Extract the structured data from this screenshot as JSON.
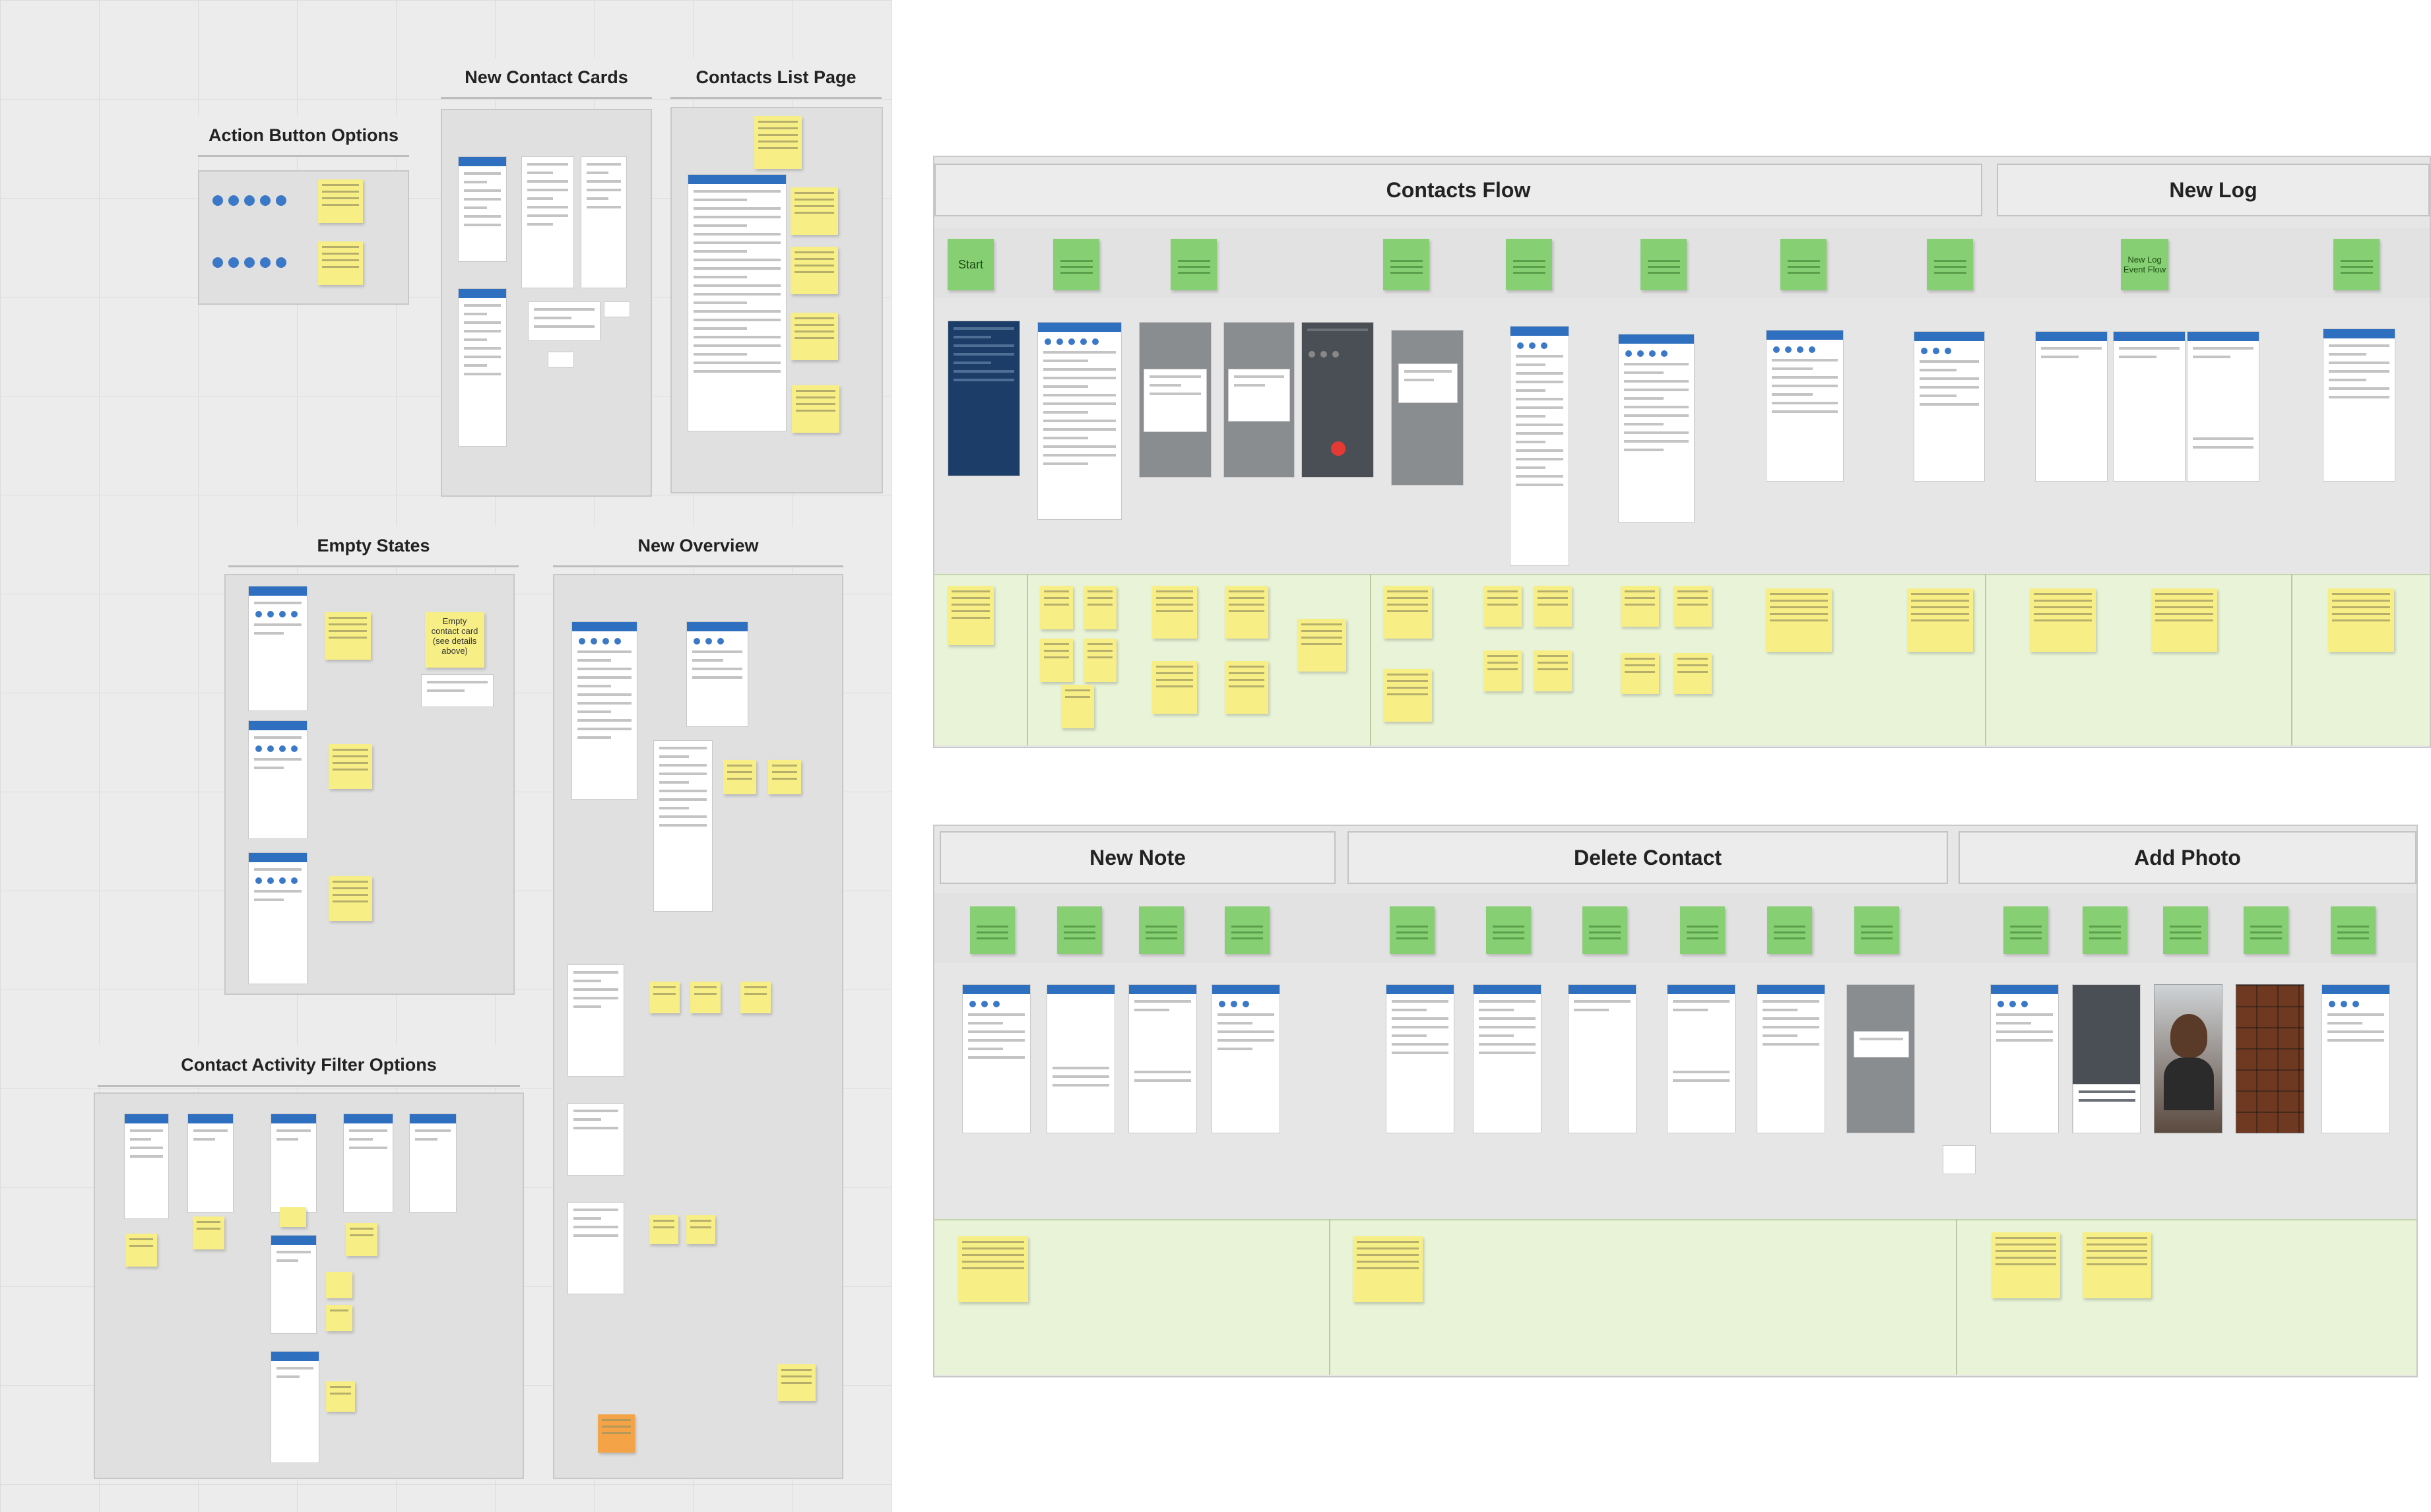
{
  "left_frames": {
    "action_button_options": "Action Button Options",
    "new_contact_cards": "New Contact Cards",
    "contacts_list_page": "Contacts List Page",
    "empty_states": "Empty States",
    "new_overview": "New Overview",
    "contact_activity_filter_options": "Contact Activity Filter Options"
  },
  "empty_states_sticky": "Empty contact card (see details above)",
  "boards": {
    "contacts_flow": "Contacts Flow",
    "new_log": "New Log",
    "new_note": "New Note",
    "delete_contact": "Delete Contact",
    "add_photo": "Add Photo"
  },
  "contacts_flow_steps": {
    "start": "Start",
    "new_log_step": "New Log Event Flow"
  },
  "colors": {
    "sticky_yellow": "#f7ef86",
    "sticky_green": "#86cf72",
    "sticky_orange": "#f4a346",
    "header_blue": "#2f6fc0",
    "lane_green": "#e8f3d8"
  }
}
